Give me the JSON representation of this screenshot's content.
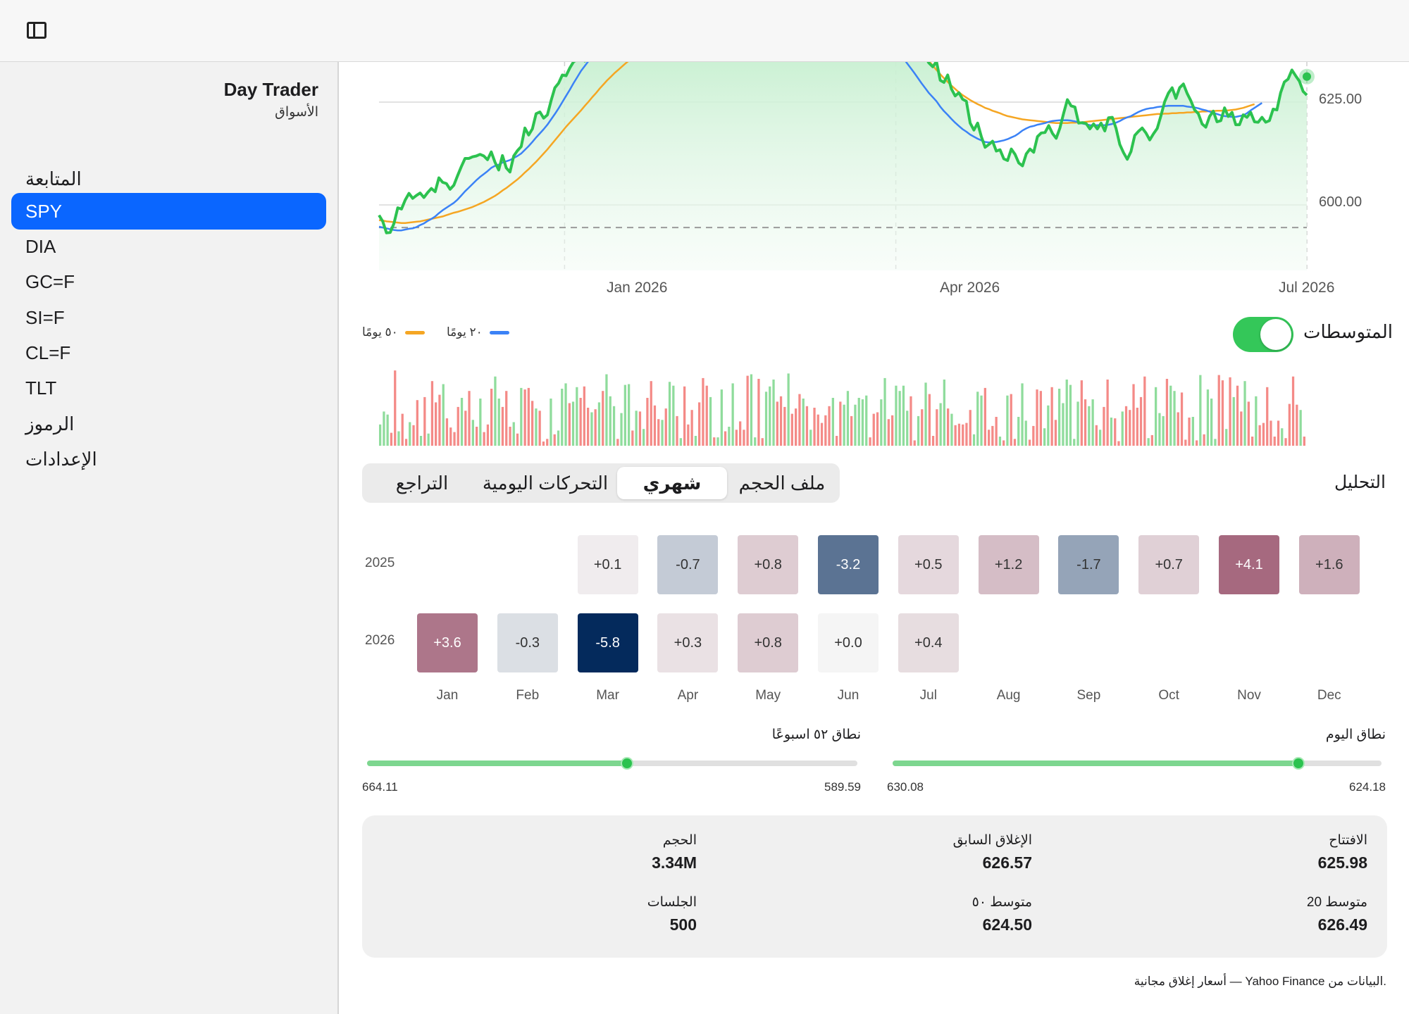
{
  "app": {
    "title": "Day Trader",
    "subtitle": "الأسواق"
  },
  "sidebar": {
    "items": [
      {
        "label": "المتابعة",
        "active": false
      },
      {
        "label": "SPY",
        "active": true
      },
      {
        "label": "DIA",
        "active": false
      },
      {
        "label": "GC=F",
        "active": false
      },
      {
        "label": "SI=F",
        "active": false
      },
      {
        "label": "CL=F",
        "active": false
      },
      {
        "label": "TLT",
        "active": false
      },
      {
        "label": "الرموز",
        "active": false
      },
      {
        "label": "الإعدادات",
        "active": false
      }
    ]
  },
  "colors": {
    "accent": "#0a66ff",
    "price": "#2cc24f",
    "ma20": "#3b82f6",
    "ma50": "#f5a623",
    "up": "#8fdc9c",
    "down": "#f48a87"
  },
  "chart_data": {
    "type": "line",
    "x_ticks": [
      "Jan 2026",
      "Apr 2026",
      "Jul 2026"
    ],
    "y_ticks": [
      "625.00",
      "600.00"
    ],
    "series": [
      {
        "name": "٢٠ يومًا",
        "color": "#3b82f6"
      },
      {
        "name": "٥٠ يومًا",
        "color": "#f5a623"
      }
    ],
    "price": [
      597.5,
      596.0,
      593.2,
      593.3,
      595.5,
      599.3,
      599.0,
      601.2,
      602.8,
      601.6,
      602.3,
      602.9,
      601.8,
      603.0,
      604.0,
      603.2,
      606.6,
      605.5,
      605.2,
      603.8,
      604.8,
      607.1,
      609.3,
      611.3,
      611.3,
      611.7,
      611.9,
      612.3,
      611.9,
      611.0,
      612.9,
      610.4,
      608.5,
      612.0,
      609.0,
      608.0,
      611.9,
      613.2,
      614.2,
      618.7,
      617.0,
      618.5,
      622.2,
      622.6,
      621.1,
      621.9,
      625.4,
      628.5,
      629.6,
      631.6,
      631.4,
      633.3,
      634.8,
      635.4,
      636.3,
      635.0,
      638.1,
      640.1,
      641.7,
      641.5,
      642.1,
      642.9,
      641.6,
      643.6,
      645.2,
      643.5,
      641.0,
      642.3,
      644.2,
      643.5,
      641.9,
      640.5,
      641.9,
      640.6,
      641.6,
      643.1,
      643.5,
      640.8,
      641.1,
      643.7,
      644.3,
      646.1,
      648.4,
      649.1,
      651.9,
      654.9,
      656.6,
      656.7,
      654.5,
      655.4,
      656.1,
      655.0,
      653.3,
      654.5,
      657.1,
      659.0,
      659.6,
      660.3,
      659.5,
      658.8,
      660.3,
      660.3,
      662.1,
      661.1,
      662.6,
      662.9,
      663.7,
      661.6,
      659.4,
      657.9,
      659.7,
      660.8,
      660.9,
      662.0,
      660.3,
      662.4,
      663.3,
      661.9,
      662.6,
      663.8,
      663.0,
      661.9,
      663.5,
      663.5,
      662.2,
      661.5,
      661.1,
      660.1,
      659.8,
      657.6,
      656.0,
      653.5,
      651.9,
      649.9,
      649.2,
      648.4,
      646.7,
      644.5,
      645.2,
      644.3,
      642.7,
      641.0,
      639.2,
      638.6,
      640.5,
      638.2,
      635.9,
      634.5,
      633.6,
      634.9,
      630.3,
      629.8,
      631.6,
      628.2,
      626.5,
      627.3,
      625.7,
      625.2,
      619.9,
      618.2,
      619.9,
      616.6,
      614.0,
      614.7,
      615.5,
      613.1,
      613.4,
      611.2,
      610.8,
      613.6,
      612.3,
      610.2,
      609.5,
      612.4,
      613.6,
      612.8,
      616.6,
      617.5,
      617.6,
      619.3,
      617.4,
      616.2,
      618.7,
      622.3,
      625.6,
      624.1,
      623.8,
      619.9,
      620.0,
      619.8,
      618.5,
      619.7,
      618.5,
      619.9,
      618.0,
      621.2,
      621.3,
      618.6,
      614.7,
      612.7,
      611.1,
      613.0,
      616.9,
      617.9,
      618.7,
      617.5,
      615.8,
      617.3,
      618.6,
      621.7,
      625.1,
      627.2,
      628.5,
      625.9,
      628.5,
      629.4,
      627.1,
      625.3,
      623.1,
      622.2,
      619.7,
      618.9,
      621.5,
      622.8,
      620.2,
      620.5,
      623.6,
      621.5,
      622.5,
      619.5,
      619.5,
      621.9,
      621.3,
      622.5,
      620.2,
      620.1,
      621.3,
      620.1,
      620.5,
      623.3,
      623.1,
      627.3,
      629.9,
      630.6,
      632.8,
      631.4,
      630.1,
      627.6,
      626.7
    ],
    "ma20": [
      594.7,
      594.5,
      594.3,
      594.1,
      593.9,
      593.8,
      593.8,
      594.0,
      594.2,
      594.3,
      594.6,
      595.1,
      595.5,
      596.1,
      596.6,
      597.2,
      598.0,
      598.7,
      599.3,
      599.9,
      600.5,
      601.3,
      602.3,
      603.3,
      604.2,
      605.1,
      606.0,
      606.8,
      607.5,
      608.2,
      609.0,
      609.5,
      609.8,
      610.3,
      610.6,
      610.9,
      611.4,
      611.9,
      612.5,
      613.4,
      614.3,
      615.3,
      616.4,
      617.4,
      618.4,
      619.5,
      620.8,
      622.1,
      623.5,
      625.0,
      626.5,
      628.0,
      629.6,
      631.1,
      632.6,
      633.8,
      635.0,
      636.1,
      637.1,
      637.9,
      638.7,
      639.3,
      639.9,
      640.6,
      641.2,
      641.7,
      642.1,
      642.6,
      643.0,
      643.4,
      643.6,
      643.7,
      644.0,
      644.3,
      644.5,
      644.8,
      645.2,
      645.5,
      645.8,
      646.2,
      646.7,
      647.3,
      648.0,
      648.7,
      649.6,
      650.7,
      651.8,
      652.9,
      653.8,
      654.6,
      655.5,
      656.3,
      657.0,
      657.7,
      658.4,
      659.2,
      659.8,
      660.4,
      660.9,
      661.2,
      661.5,
      661.8,
      662.2,
      662.4,
      662.6,
      662.9,
      663.1,
      663.0,
      662.8,
      662.6,
      662.4,
      662.2,
      662.0,
      661.6,
      661.2,
      660.8,
      660.3,
      659.8,
      659.3,
      658.7,
      658.0,
      657.2,
      656.5,
      655.6,
      654.8,
      653.9,
      653.0,
      652.0,
      651.0,
      649.8,
      648.6,
      647.3,
      646.0,
      644.7,
      643.4,
      642.1,
      640.9,
      639.6,
      638.4,
      637.2,
      635.9,
      634.6,
      633.4,
      632.2,
      630.9,
      629.6,
      628.4,
      627.2,
      626.2,
      625.2,
      623.9,
      622.8,
      621.9,
      620.9,
      620.0,
      619.2,
      618.4,
      617.8,
      617.1,
      616.6,
      616.1,
      615.7,
      615.3,
      615.2,
      615.3,
      615.3,
      615.5,
      615.7,
      616.0,
      616.4,
      616.8,
      617.4,
      618.1,
      618.6,
      619.0,
      619.2,
      619.5,
      619.7,
      619.9,
      620.2,
      620.4,
      620.5,
      620.6,
      620.6,
      620.6,
      620.5,
      620.3,
      620.1,
      619.8,
      619.6,
      619.4,
      619.3,
      619.4,
      619.4,
      619.4,
      619.5,
      619.7,
      620.0,
      620.4,
      620.9,
      621.3,
      621.6,
      622.1,
      622.6,
      623.0,
      623.3,
      623.5,
      623.6,
      623.8,
      623.9,
      624.0,
      624.1,
      624.1,
      624.1,
      624.1,
      624.1,
      623.9,
      623.8,
      623.7,
      623.5,
      623.2,
      623.0,
      622.7,
      622.4,
      622.1,
      621.8,
      621.6,
      621.5,
      621.4,
      621.4,
      621.6,
      621.8,
      622.3,
      623.0,
      623.6,
      624.2,
      624.8
    ],
    "ma50": [
      596.3,
      596.2,
      596.0,
      595.9,
      595.8,
      595.7,
      595.6,
      595.6,
      595.7,
      595.8,
      595.9,
      596.0,
      596.2,
      596.4,
      596.6,
      596.8,
      597.0,
      597.2,
      597.5,
      597.8,
      598.1,
      598.3,
      598.6,
      598.9,
      599.2,
      599.5,
      599.9,
      600.3,
      600.7,
      601.2,
      601.7,
      602.2,
      602.8,
      603.5,
      604.1,
      604.8,
      605.5,
      606.2,
      607.0,
      607.9,
      608.7,
      609.6,
      610.5,
      611.5,
      612.5,
      613.5,
      614.6,
      615.7,
      616.8,
      617.9,
      619.0,
      620.0,
      621.0,
      622.0,
      623.0,
      624.1,
      625.1,
      626.2,
      627.2,
      628.3,
      629.3,
      630.3,
      631.2,
      632.1,
      632.9,
      633.7,
      634.5,
      635.2,
      635.9,
      636.7,
      637.4,
      638.1,
      638.8,
      639.5,
      640.2,
      640.9,
      641.5,
      642.2,
      642.9,
      643.6,
      644.2,
      644.9,
      645.6,
      646.3,
      647.0,
      647.7,
      648.4,
      649.2,
      649.9,
      650.7,
      651.4,
      652.1,
      652.8,
      653.5,
      654.1,
      654.8,
      655.4,
      656.1,
      656.7,
      657.3,
      657.9,
      658.4,
      658.9,
      659.3,
      659.6,
      659.9,
      660.1,
      660.3,
      660.4,
      660.5,
      660.5,
      660.5,
      660.4,
      660.3,
      660.2,
      660.0,
      659.8,
      659.5,
      659.2,
      658.8,
      658.4,
      657.9,
      657.4,
      656.9,
      656.3,
      655.8,
      655.1,
      654.5,
      653.8,
      653.1,
      652.4,
      651.6,
      650.8,
      649.9,
      649.0,
      648.1,
      647.2,
      646.2,
      645.2,
      644.1,
      643.0,
      641.8,
      640.7,
      639.5,
      638.4,
      637.3,
      636.1,
      635.0,
      633.9,
      632.8,
      631.8,
      630.8,
      629.9,
      629.0,
      628.2,
      627.4,
      626.7,
      626.1,
      625.5,
      625.0,
      624.5,
      624.1,
      623.6,
      623.3,
      622.9,
      622.6,
      622.3,
      621.9,
      621.6,
      621.4,
      621.2,
      621.0,
      620.8,
      620.7,
      620.6,
      620.5,
      620.4,
      620.3,
      620.2,
      620.1,
      620.0,
      619.9,
      619.9,
      619.9,
      619.9,
      620.0,
      620.0,
      620.1,
      620.1,
      620.2,
      620.3,
      620.4,
      620.5,
      620.6,
      620.7,
      620.8,
      620.9,
      621.0,
      621.1,
      621.2,
      621.3,
      621.4,
      621.5,
      621.6,
      621.7,
      621.8,
      621.9,
      622.0,
      622.1,
      622.1,
      622.2,
      622.2,
      622.3,
      622.3,
      622.4,
      622.4,
      622.5,
      622.5,
      622.6,
      622.6,
      622.7,
      622.7,
      622.8,
      622.8,
      622.9,
      622.9,
      623.0,
      623.0,
      623.1,
      623.2,
      623.4,
      623.6,
      623.9,
      624.2,
      624.5
    ],
    "volume": [
      0.28,
      0.45,
      0.41,
      0.17,
      0.99,
      0.19,
      0.42,
      0.09,
      0.31,
      0.27,
      0.6,
      0.13,
      0.64,
      0.16,
      0.85,
      0.57,
      0.67,
      0.81,
      0.36,
      0.24,
      0.18,
      0.51,
      0.63,
      0.46,
      0.72,
      0.34,
      0.25,
      0.62,
      0.18,
      0.28,
      0.75,
      0.91,
      0.62,
      0.51,
      0.72,
      0.25,
      0.31,
      0.16,
      0.76,
      0.74,
      0.76,
      0.59,
      0.49,
      0.46,
      0.05,
      0.09,
      0.62,
      0.15,
      0.2,
      0.75,
      0.82,
      0.56,
      0.58,
      0.77,
      0.63,
      0.78,
      0.5,
      0.44,
      0.48,
      0.57,
      0.72,
      0.94,
      0.65,
      0.52,
      0.09,
      0.43,
      0.8,
      0.81,
      0.2,
      0.46,
      0.45,
      0.22,
      0.63,
      0.85,
      0.53,
      0.35,
      0.34,
      0.49,
      0.84,
      0.79,
      0.39,
      0.1,
      0.78,
      0.28,
      0.47,
      0.13,
      0.57,
      0.89,
      0.79,
      0.64,
      0.11,
      0.11,
      0.74,
      0.19,
      0.25,
      0.82,
      0.21,
      0.32,
      0.21,
      0.92,
      0.94,
      0.11,
      0.88,
      0.1,
      0.71,
      0.78,
      0.87,
      0.58,
      0.65,
      0.51,
      0.95,
      0.42,
      0.49,
      0.68,
      0.62,
      0.52,
      0.21,
      0.5,
      0.41,
      0.3,
      0.4,
      0.52,
      0.63,
      0.13,
      0.58,
      0.54,
      0.72,
      0.39,
      0.54,
      0.63,
      0.61,
      0.66,
      0.11,
      0.42,
      0.44,
      0.61,
      0.89,
      0.35,
      0.4,
      0.79,
      0.72,
      0.79,
      0.46,
      0.65,
      0.07,
      0.39,
      0.48,
      0.83,
      0.68,
      0.13,
      0.48,
      0.56,
      0.87,
      0.49,
      0.42,
      0.27,
      0.29,
      0.28,
      0.3,
      0.47,
      0.15,
      0.71,
      0.66,
      0.76,
      0.21,
      0.26,
      0.38,
      0.12,
      0.07,
      0.66,
      0.68,
      0.09,
      0.38,
      0.82,
      0.33,
      0.08,
      0.26,
      0.74,
      0.72,
      0.23,
      0.53,
      0.77,
      0.34,
      0.75,
      0.56,
      0.87,
      0.8,
      0.09,
      0.58,
      0.86,
      0.61,
      0.52,
      0.61,
      0.27,
      0.21,
      0.51,
      0.87,
      0.37,
      0.36,
      0.06,
      0.45,
      0.52,
      0.47,
      0.81,
      0.5,
      0.64,
      0.91,
      0.1,
      0.14,
      0.77,
      0.43,
      0.39,
      0.88,
      0.79,
      0.72,
      0.44,
      0.7,
      0.08,
      0.37,
      0.38,
      0.07,
      0.93,
      0.15,
      0.74,
      0.62,
      0.09,
      0.93,
      0.86,
      0.22,
      0.9,
      0.64,
      0.79,
      0.45,
      0.85,
      0.58,
      0.12,
      0.65,
      0.27,
      0.3,
      0.77,
      0.33,
      0.12,
      0.33,
      0.23,
      0.1,
      0.55,
      0.91,
      0.54,
      0.47,
      0.12
    ],
    "volume_up": [
      true,
      true,
      true,
      false,
      false,
      true,
      false,
      false,
      true,
      false,
      false,
      true,
      false,
      true,
      false,
      false,
      false,
      true,
      false,
      false,
      false,
      false,
      true,
      false,
      false,
      true,
      false,
      true,
      false,
      false,
      false,
      true,
      true,
      false,
      false,
      false,
      true,
      false,
      true,
      false,
      false,
      false,
      true,
      false,
      false,
      false,
      true,
      false,
      true,
      true,
      true,
      false,
      true,
      true,
      false,
      false,
      false,
      true,
      false,
      true,
      false,
      true,
      true,
      true,
      false,
      true,
      true,
      true,
      false,
      true,
      false,
      true,
      false,
      false,
      false,
      false,
      true,
      false,
      true,
      true,
      false,
      true,
      false,
      false,
      false,
      true,
      false,
      false,
      false,
      true,
      false,
      true,
      true,
      false,
      true,
      true,
      false,
      false,
      false,
      false,
      true,
      true,
      false,
      false,
      true,
      true,
      true,
      false,
      false,
      false,
      true,
      false,
      false,
      false,
      true,
      false,
      true,
      false,
      false,
      false,
      false,
      false,
      true,
      false,
      false,
      true,
      true,
      false,
      true,
      true,
      true,
      true,
      false,
      false,
      false,
      true,
      true,
      false,
      false,
      true,
      true,
      true,
      true,
      false,
      false,
      true,
      false,
      true,
      false,
      false,
      false,
      true,
      true,
      false,
      true,
      false,
      false,
      false,
      false,
      false,
      true,
      true,
      true,
      false,
      false,
      false,
      false,
      true,
      false,
      true,
      false,
      false,
      true,
      true,
      true,
      false,
      false,
      false,
      false,
      true,
      true,
      false,
      false,
      true,
      true,
      true,
      true,
      true,
      true,
      false,
      false,
      true,
      true,
      false,
      true,
      false,
      false,
      true,
      false,
      false,
      true,
      false,
      false,
      false,
      false,
      false,
      false,
      true,
      false,
      true,
      true,
      true,
      false,
      true,
      true,
      false,
      false,
      false,
      false,
      true,
      false,
      true,
      false,
      true,
      true,
      true,
      false,
      false,
      true,
      false,
      true,
      false,
      false,
      true,
      false,
      false,
      true,
      false,
      false,
      false,
      false,
      false,
      false,
      true,
      false,
      false,
      false,
      false,
      true,
      false
    ]
  },
  "chart_text": {
    "ma_toggle_label": "المتوسطات",
    "legend_ma20": "٢٠ يومًا",
    "legend_ma50": "٥٠ يومًا"
  },
  "analysis": {
    "title": "التحليل",
    "tabs": [
      "ملف الحجم",
      "شهري",
      "التحركات اليومية",
      "التراجع"
    ],
    "selected_tab": "شهري",
    "years": [
      "2025",
      "2026"
    ],
    "months": [
      "Jan",
      "Feb",
      "Mar",
      "Apr",
      "May",
      "Jun",
      "Jul",
      "Aug",
      "Sep",
      "Oct",
      "Nov",
      "Dec"
    ],
    "rows": [
      [
        "",
        "",
        "+0.1",
        "-0.7",
        "+0.8",
        "-3.2",
        "+0.5",
        "+1.2",
        "-1.7",
        "+0.7",
        "+4.1",
        "+1.6"
      ],
      [
        "+3.6",
        "-0.3",
        "-5.8",
        "+0.3",
        "+0.8",
        "+0.0",
        "+0.4",
        "",
        "",
        "",
        "",
        ""
      ]
    ]
  },
  "ranges": {
    "day_label": "نطاق اليوم",
    "day_low": "630.08",
    "day_high": "624.18",
    "day_fraction": 0.83,
    "week52_label": "نطاق ٥٢ اسبوعًا",
    "week52_low": "664.11",
    "week52_high": "589.59",
    "week52_fraction": 0.53
  },
  "stats": {
    "open_label": "الافتتاح",
    "open": "625.98",
    "prev_close_label": "الإغلاق السابق",
    "prev_close": "626.57",
    "volume_label": "الحجم",
    "volume": "3.34M",
    "ma20_label": "متوسط 20",
    "ma20": "626.49",
    "ma50_label": "متوسط ٥٠",
    "ma50": "624.50",
    "sessions_label": "الجلسات",
    "sessions": "500"
  },
  "footer": "أسعار إغلاق مجانية — Yahoo Finance البيانات من."
}
